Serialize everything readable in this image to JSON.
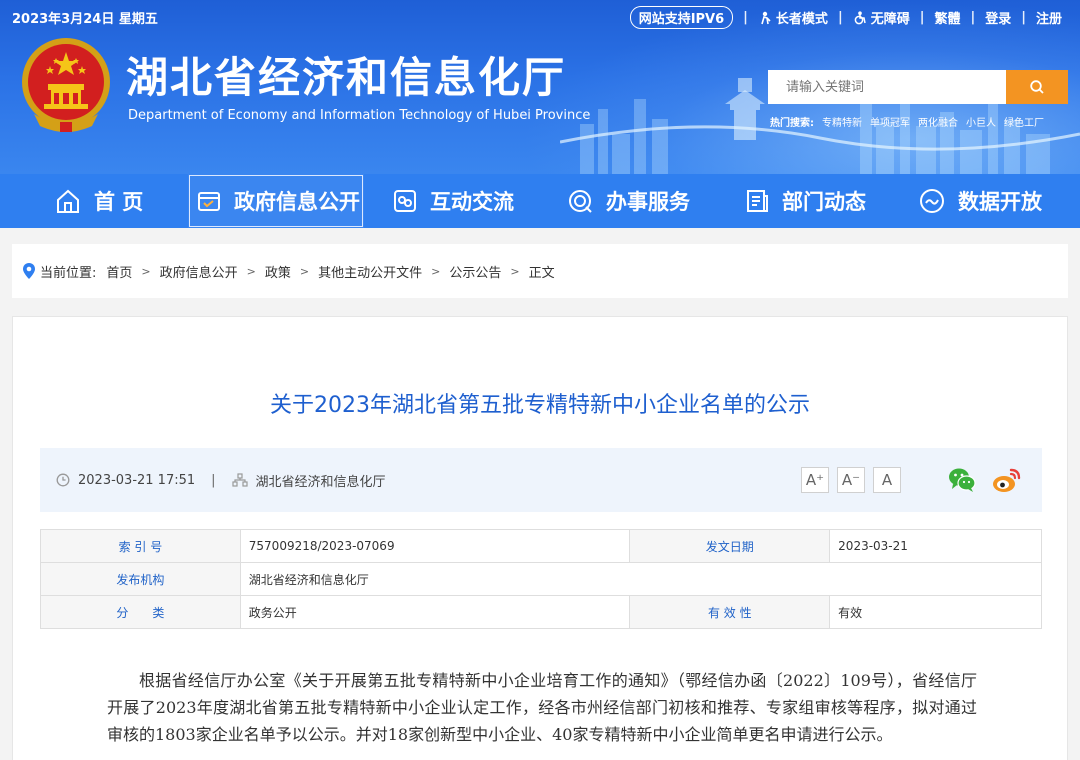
{
  "header": {
    "date": "2023年3月24日 星期五",
    "title": "湖北省经济和信息化厅",
    "subtitle": "Department of Economy and Information Technology of Hubei Province",
    "top_links": {
      "ipv6": "网站支持IPV6",
      "elder": "长者模式",
      "accessible": "无障碍",
      "traditional": "繁體",
      "login": "登录",
      "register": "注册"
    },
    "search": {
      "placeholder": "请输入关键词"
    },
    "hot": {
      "label": "热门搜索:",
      "items": [
        "专精特新",
        "单项冠军",
        "两化融合",
        "小巨人",
        "绿色工厂"
      ]
    }
  },
  "nav": {
    "items": [
      "首 页",
      "政府信息公开",
      "互动交流",
      "办事服务",
      "部门动态",
      "数据开放"
    ],
    "active_index": 1
  },
  "breadcrumb": {
    "label": "当前位置:",
    "items": [
      "首页",
      "政府信息公开",
      "政策",
      "其他主动公开文件",
      "公示公告",
      "正文"
    ]
  },
  "article": {
    "title": "关于2023年湖北省第五批专精特新中小企业名单的公示",
    "datetime": "2023-03-21 17:51",
    "source": "湖北省经济和信息化厅",
    "font_buttons": [
      "A⁺",
      "A⁻",
      "A"
    ],
    "share": [
      "wechat-icon",
      "weibo-icon"
    ],
    "info_table": {
      "index_label": "索 引 号",
      "index_value": "757009218/2023-07069",
      "date_label": "发文日期",
      "date_value": "2023-03-21",
      "org_label": "发布机构",
      "org_value": "湖北省经济和信息化厅",
      "category_label": "分　　类",
      "category_value": "政务公开",
      "validity_label": "有 效 性",
      "validity_value": "有效"
    },
    "body": "根据省经信厅办公室《关于开展第五批专精特新中小企业培育工作的通知》（鄂经信办函〔2022〕109号），省经信厅开展了2023年度湖北省第五批专精特新中小企业认定工作，经各市州经信部门初核和推荐、专家组审核等程序，拟对通过审核的1803家企业名单予以公示。并对18家创新型中小企业、40家专精特新中小企业简单更名申请进行公示。"
  },
  "colors": {
    "header_blue": "#2b72e6",
    "nav_blue": "#2f7ff0",
    "search_orange": "#f39422",
    "title_blue": "#1e5fcf",
    "wechat_green": "#3bb03b",
    "weibo_orange": "#f39422"
  }
}
